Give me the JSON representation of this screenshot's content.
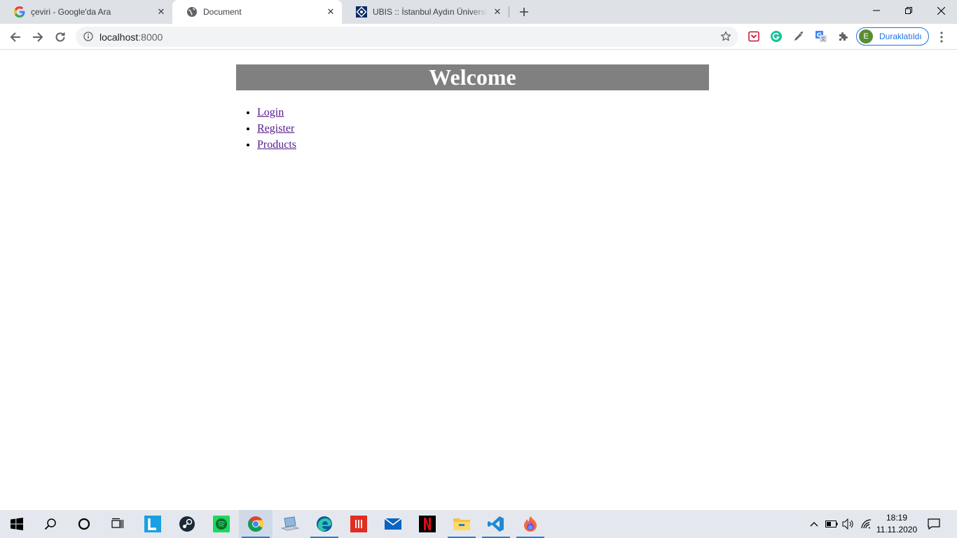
{
  "browser": {
    "tabs": [
      {
        "title": "çeviri - Google'da Ara",
        "icon": "google-g-icon"
      },
      {
        "title": "Document",
        "icon": "globe-icon"
      },
      {
        "title": "UBIS :: İstanbul Aydın Üniversitesi",
        "icon": "ubis-logo-icon"
      }
    ],
    "active_tab_index": 1,
    "address": {
      "host": "localhost",
      "port": ":8000"
    },
    "profile": {
      "initial": "E",
      "status": "Duraklatıldı"
    },
    "extensions": [
      "pocket-icon",
      "grammarly-icon",
      "eyedropper-icon",
      "google-translate-icon",
      "puzzle-icon"
    ],
    "accent_color": "#1a73e8"
  },
  "page": {
    "banner_text": "Welcome",
    "banner_color": "#808080",
    "links": [
      "Login",
      "Register",
      "Products"
    ],
    "link_color": "#551a8b"
  },
  "taskbar": {
    "apps": [
      "start-icon",
      "search-icon",
      "cortana-icon",
      "task-view-icon",
      "lightshot-icon",
      "steam-icon",
      "spotify-icon",
      "chrome-icon",
      "laptop-icon",
      "edge-icon",
      "office-icon",
      "mail-icon",
      "netflix-icon",
      "file-explorer-icon",
      "vscode-icon",
      "firefox-dev-icon"
    ],
    "time": "18:19",
    "date": "11.11.2020"
  }
}
